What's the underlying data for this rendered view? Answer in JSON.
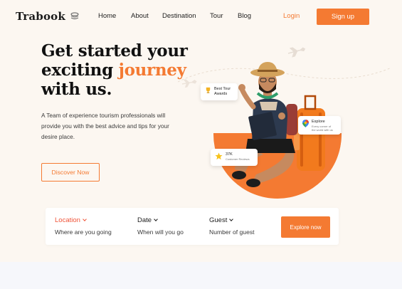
{
  "header": {
    "logo_text": "Trabook",
    "nav": [
      "Home",
      "About",
      "Destination",
      "Tour",
      "Blog"
    ],
    "login_label": "Login",
    "signup_label": "Sign up"
  },
  "hero": {
    "headline_line1": "Get started your",
    "headline_line2_pre": "exciting ",
    "headline_line2_accent": "journey",
    "headline_line3": "with us.",
    "description": "A Team of experience tourism professionals will provide you with the best advice and tips for your desire place.",
    "cta_label": "Discover Now"
  },
  "badges": {
    "award_title_1": "Best Tour",
    "award_title_2": "Awards",
    "explore_title": "Explore",
    "explore_sub_1": "Every corner of",
    "explore_sub_2": "the world with us",
    "reviews_title": "37K",
    "reviews_sub": "Customer Reviews"
  },
  "search": {
    "location_label": "Location",
    "location_value": "Where are you going",
    "date_label": "Date",
    "date_value": "When will you go",
    "guest_label": "Guest",
    "guest_value": "Number of guest",
    "button_label": "Explore now"
  },
  "colors": {
    "accent": "#f47a32",
    "location_label": "#f0553a",
    "hero_bg": "#fcf7f1"
  },
  "icons": [
    "stack-icon",
    "trophy-icon",
    "map-pin-icon",
    "star-icon",
    "airplane-icon",
    "chevron-down-icon"
  ]
}
